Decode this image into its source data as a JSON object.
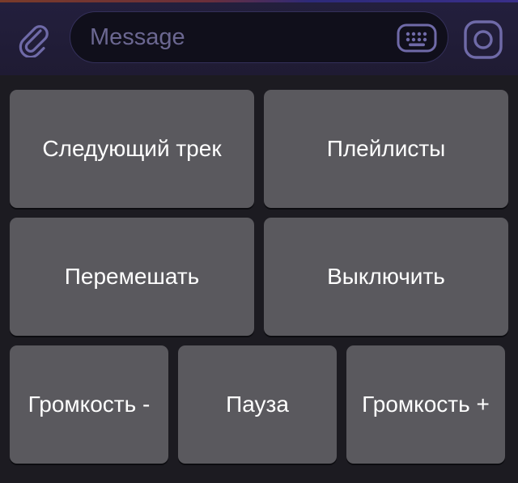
{
  "input_bar": {
    "placeholder": "Message",
    "value": "",
    "attach_icon": "paperclip-icon",
    "keyboard_icon": "keyboard-icon",
    "sticker_icon": "sticker-icon"
  },
  "reply_keyboard": {
    "rows": [
      [
        "Следующий трек",
        "Плейлисты"
      ],
      [
        "Перемешать",
        "Выключить"
      ],
      [
        "Громкость -",
        "Пауза",
        "Громкость +"
      ]
    ]
  },
  "colors": {
    "bar_background": "#231f3d",
    "field_background": "#100f1b",
    "placeholder": "#6b6791",
    "icon": "#6f6aa8",
    "keyboard_background": "#1c1b21",
    "button": "#5a595e",
    "button_text": "#ffffff"
  }
}
